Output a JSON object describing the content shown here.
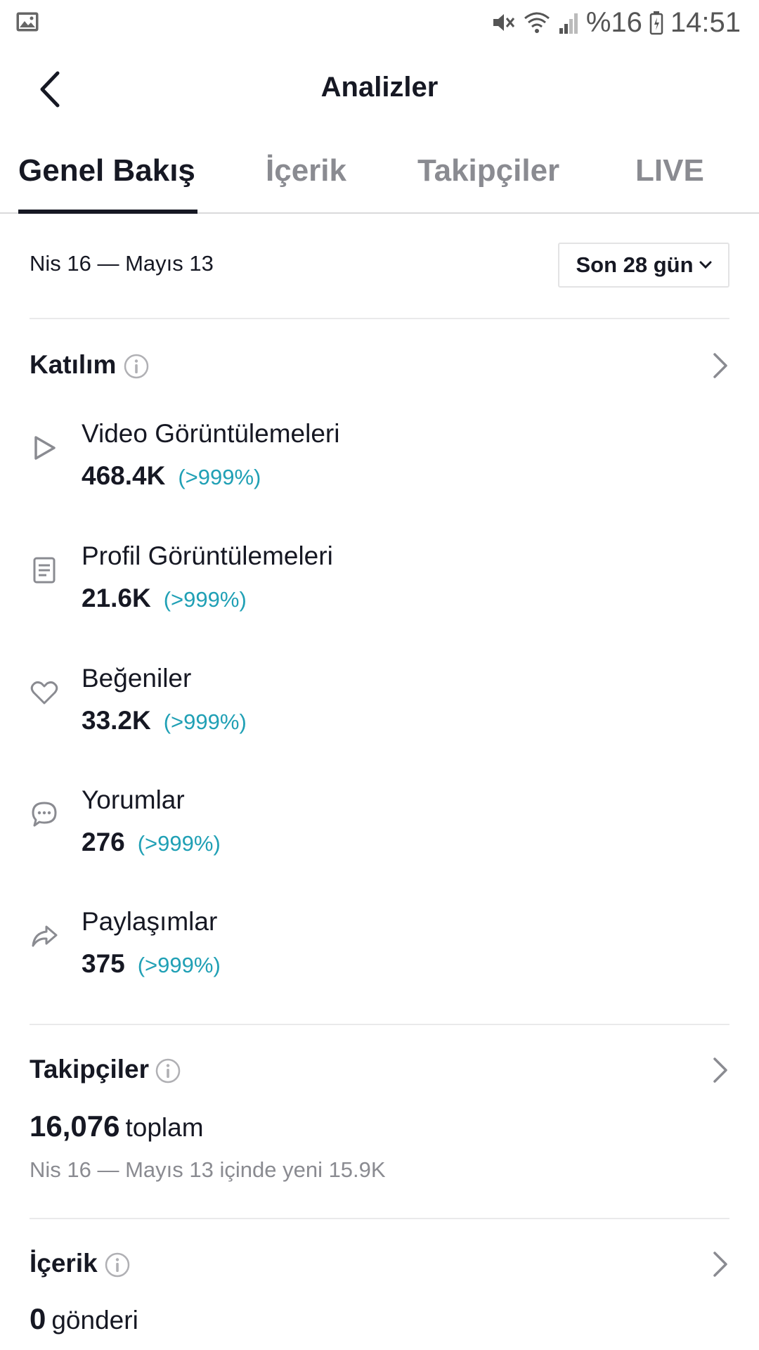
{
  "status_bar": {
    "battery": "%16",
    "time": "14:51",
    "icons": [
      "image-icon",
      "mute-icon",
      "wifi-icon",
      "signal-icon",
      "battery-icon"
    ]
  },
  "header": {
    "title": "Analizler",
    "back_icon": "chevron-left-icon"
  },
  "tabs": [
    {
      "label": "Genel Bakış",
      "active": true
    },
    {
      "label": "İçerik",
      "active": false
    },
    {
      "label": "Takipçiler",
      "active": false
    },
    {
      "label": "LIVE",
      "active": false
    }
  ],
  "date_filter": {
    "range": "Nis 16 — Mayıs 13",
    "selected_period": "Son 28 gün"
  },
  "engagement": {
    "title": "Katılım",
    "metrics": [
      {
        "icon": "play-icon",
        "label": "Video Görüntülemeleri",
        "value": "468.4K",
        "change": "(>999%)"
      },
      {
        "icon": "profile-page-icon",
        "label": "Profil Görüntülemeleri",
        "value": "21.6K",
        "change": "(>999%)"
      },
      {
        "icon": "heart-icon",
        "label": "Beğeniler",
        "value": "33.2K",
        "change": "(>999%)"
      },
      {
        "icon": "comment-icon",
        "label": "Yorumlar",
        "value": "276",
        "change": "(>999%)"
      },
      {
        "icon": "share-icon",
        "label": "Paylaşımlar",
        "value": "375",
        "change": "(>999%)"
      }
    ]
  },
  "followers": {
    "title": "Takipçiler",
    "total": "16,076",
    "total_suffix": "toplam",
    "note": "Nis 16 — Mayıs 13 içinde yeni 15.9K"
  },
  "content": {
    "title": "İçerik",
    "count": "0",
    "count_suffix": "gönderi"
  },
  "colors": {
    "text_primary": "#161823",
    "text_secondary": "#8a8b91",
    "accent_change": "#20a0b5",
    "divider": "#e9e9ea"
  }
}
